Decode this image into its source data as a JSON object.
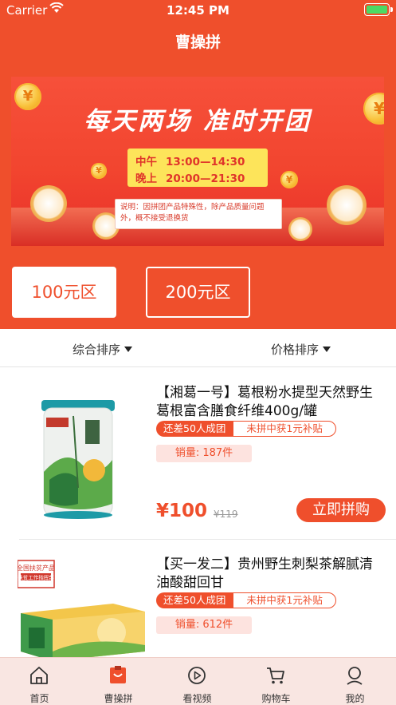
{
  "status_bar": {
    "carrier": "Carrier",
    "time": "12:45 PM"
  },
  "nav": {
    "title": "曹操拼"
  },
  "banner": {
    "headline": "每天两场  准时开团",
    "schedule": [
      {
        "label": "中午",
        "time": "13:00—14:30"
      },
      {
        "label": "晚上",
        "time": "20:00—21:30"
      }
    ],
    "note": "说明：因拼团产品特殊性，除产品质量问题外，概不接受退换货",
    "coin_symbol": "¥"
  },
  "zones": {
    "active": "100元区",
    "inactive": "200元区"
  },
  "sort": {
    "general": "综合排序",
    "price": "价格排序"
  },
  "products": [
    {
      "title": "【湘葛一号】葛根粉水提型天然野生葛根富含膳食纤维400g/罐",
      "tag_short": "还差50人成团",
      "tag_subsidy": "未拼中获1元补贴",
      "sales": "销量: 187件",
      "price": "¥100",
      "original_price": "¥119",
      "buy_label": "立即拼购"
    },
    {
      "title": "【买一发二】贵州野生刺梨茶解腻清油酸甜回甘",
      "tag_short": "还差50人成团",
      "tag_subsidy": "未拼中获1元补贴",
      "sales": "销量: 612件",
      "badge_line1": "全国扶贫产品",
      "badge_line2": "扶贫工作指挥部"
    }
  ],
  "tabbar": [
    {
      "label": "首页",
      "icon": "home-icon"
    },
    {
      "label": "曹操拼",
      "icon": "group-buy-icon"
    },
    {
      "label": "看视频",
      "icon": "play-icon"
    },
    {
      "label": "购物车",
      "icon": "cart-icon"
    },
    {
      "label": "我的",
      "icon": "user-icon"
    }
  ],
  "colors": {
    "brand": "#ef4f2c",
    "battery": "#4cd964",
    "tabbar_bg": "#f9e6e2"
  }
}
